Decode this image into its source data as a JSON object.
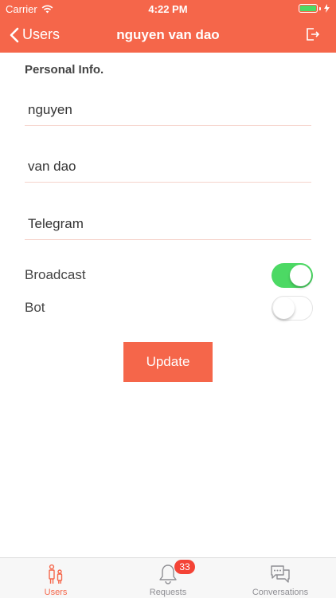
{
  "status_bar": {
    "carrier": "Carrier",
    "time": "4:22 PM"
  },
  "nav": {
    "back_label": "Users",
    "title": "nguyen van dao"
  },
  "form": {
    "section_title": "Personal Info.",
    "first_name": "nguyen",
    "last_name": "van dao",
    "platform": "Telegram",
    "broadcast_label": "Broadcast",
    "broadcast_on": true,
    "bot_label": "Bot",
    "bot_on": false,
    "update_label": "Update"
  },
  "tabbar": {
    "tabs": [
      {
        "label": "Users",
        "icon": "users-icon",
        "active": true
      },
      {
        "label": "Requests",
        "icon": "bell-icon",
        "badge": "33"
      },
      {
        "label": "Conversations",
        "icon": "chat-bubbles-icon"
      }
    ]
  },
  "colors": {
    "accent": "#f5664a",
    "toggle_on": "#4cd964",
    "badge": "#f44336"
  }
}
